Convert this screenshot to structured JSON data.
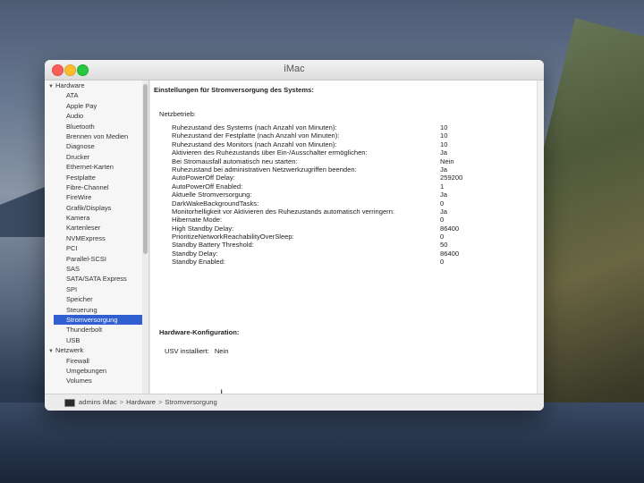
{
  "window": {
    "title": "iMac"
  },
  "sidebar": {
    "groups": [
      {
        "label": "Hardware",
        "items": [
          "ATA",
          "Apple Pay",
          "Audio",
          "Bluetooth",
          "Brennen von Medien",
          "Diagnose",
          "Drucker",
          "Ethernet-Karten",
          "Festplatte",
          "Fibre-Channel",
          "FireWire",
          "Grafik/Displays",
          "Kamera",
          "Kartenleser",
          "NVMExpress",
          "PCI",
          "Parallel-SCSI",
          "SAS",
          "SATA/SATA Express",
          "SPI",
          "Speicher",
          "Steuerung",
          "Stromversorgung",
          "Thunderbolt",
          "USB"
        ]
      },
      {
        "label": "Netzwerk",
        "items": [
          "Firewall",
          "Umgebungen",
          "Volumes"
        ]
      }
    ],
    "selected": "Stromversorgung"
  },
  "main": {
    "heading": "Einstellungen für Stromversorgung des Systems:",
    "section_label": "Netzbetrieb:",
    "rows": [
      {
        "k": "Ruhezustand des Systems (nach Anzahl von Minuten):",
        "v": "10"
      },
      {
        "k": "Ruhezustand der Festplatte (nach Anzahl von Minuten):",
        "v": "10"
      },
      {
        "k": "Ruhezustand des Monitors (nach Anzahl von Minuten):",
        "v": "10"
      },
      {
        "k": "Aktivieren des Ruhezustands über Ein-/Ausschalter ermöglichen:",
        "v": "Ja"
      },
      {
        "k": "Bei Stromausfall automatisch neu starten:",
        "v": "Nein"
      },
      {
        "k": "Ruhezustand bei administrativen Netzwerkzugriffen beenden:",
        "v": "Ja"
      },
      {
        "k": "AutoPowerOff Delay:",
        "v": "259200"
      },
      {
        "k": "AutoPowerOff Enabled:",
        "v": "1"
      },
      {
        "k": "Aktuelle Stromversorgung:",
        "v": "Ja"
      },
      {
        "k": "DarkWakeBackgroundTasks:",
        "v": "0"
      },
      {
        "k": "Monitorhelligkeit vor Aktivieren des Ruhezustands automatisch verringern:",
        "v": "Ja"
      },
      {
        "k": "Hibernate Mode:",
        "v": "0"
      },
      {
        "k": "High Standby Delay:",
        "v": "86400"
      },
      {
        "k": "PrioritizeNetworkReachabilityOverSleep:",
        "v": "0"
      },
      {
        "k": "Standby Battery Threshold:",
        "v": "50"
      },
      {
        "k": "Standby Delay:",
        "v": "86400"
      },
      {
        "k": "Standby Enabled:",
        "v": "0"
      }
    ],
    "hardware_title": "Hardware-Konfiguration:",
    "ups_label": "USV installiert:",
    "ups_value": "Nein"
  },
  "pathbar": {
    "items": [
      "admins iMac",
      "Hardware",
      "Stromversorgung"
    ],
    "separator": ">"
  }
}
